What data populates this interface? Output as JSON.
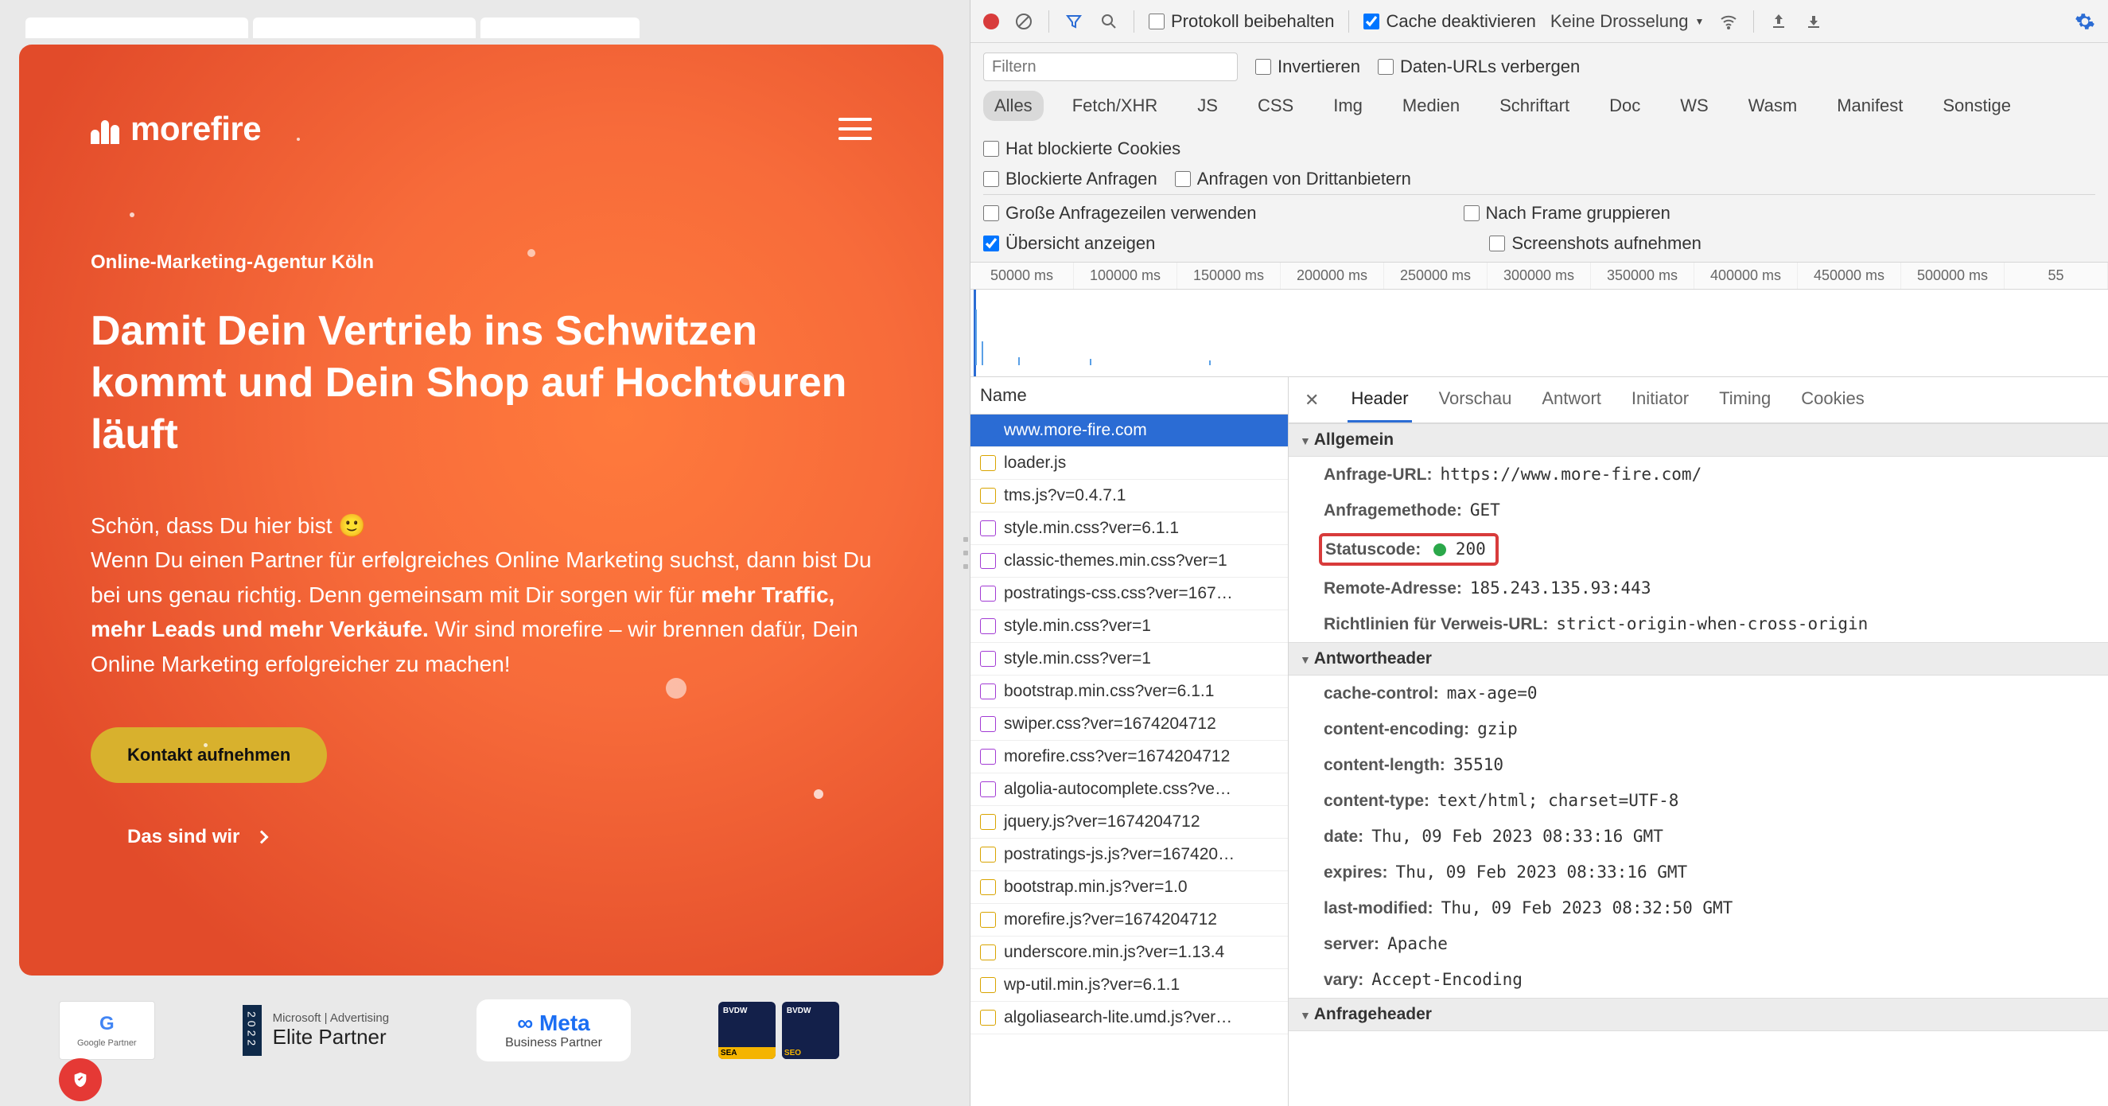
{
  "site": {
    "logo_text": "morefire",
    "eyebrow": "Online-Marketing-Agentur Köln",
    "headline": "Damit Dein Vertrieb ins Schwitzen kommt und Dein Shop auf Hochtouren läuft",
    "intro_l1": "Schön, dass Du hier bist 🙂",
    "intro_l2a": "Wenn Du einen Partner für erfolgreiches Online Marketing suchst, dann bist Du bei uns genau richtig. Denn gemeinsam mit Dir sorgen wir für ",
    "intro_bold": "mehr Traffic, mehr Leads und mehr Verkäufe.",
    "intro_l2b": " Wir sind morefire – wir brennen dafür, Dein Online Marketing erfolgreicher zu machen!",
    "cta_primary": "Kontakt aufnehmen",
    "cta_secondary": "Das sind wir",
    "partners": {
      "google_l1": "G",
      "google_l2": "Google Partner",
      "ms_l1": "Microsoft | Advertising",
      "ms_l2": "Elite Partner",
      "ms_year": "2022",
      "meta_l1": "∞ Meta",
      "meta_l2": "Business Partner",
      "bvdw_l1": "BVDW",
      "bvdw_sea": "SEA",
      "bvdw_seo": "SEO"
    }
  },
  "devtools": {
    "toolbar": {
      "preserve_log": "Protokoll beibehalten",
      "disable_cache": "Cache deaktivieren",
      "throttling": "Keine Drosselung"
    },
    "filter": {
      "placeholder": "Filtern",
      "invert": "Invertieren",
      "hide_data_urls": "Daten-URLs verbergen"
    },
    "types": [
      "Alles",
      "Fetch/XHR",
      "JS",
      "CSS",
      "Img",
      "Medien",
      "Schriftart",
      "Doc",
      "WS",
      "Wasm",
      "Manifest",
      "Sonstige"
    ],
    "blocked_cookies": "Hat blockierte Cookies",
    "blocked_requests": "Blockierte Anfragen",
    "third_party": "Anfragen von Drittanbietern",
    "large_rows": "Große Anfragezeilen verwenden",
    "group_by_frame": "Nach Frame gruppieren",
    "show_overview": "Übersicht anzeigen",
    "screenshots": "Screenshots aufnehmen",
    "timeline_ticks": [
      "50000 ms",
      "100000 ms",
      "150000 ms",
      "200000 ms",
      "250000 ms",
      "300000 ms",
      "350000 ms",
      "400000 ms",
      "450000 ms",
      "500000 ms",
      "55"
    ],
    "name_header": "Name",
    "requests": [
      {
        "name": "www.more-fire.com",
        "type": "doc",
        "selected": true
      },
      {
        "name": "loader.js",
        "type": "js"
      },
      {
        "name": "tms.js?v=0.4.7.1",
        "type": "js"
      },
      {
        "name": "style.min.css?ver=6.1.1",
        "type": "css"
      },
      {
        "name": "classic-themes.min.css?ver=1",
        "type": "css"
      },
      {
        "name": "postratings-css.css?ver=167…",
        "type": "css"
      },
      {
        "name": "style.min.css?ver=1",
        "type": "css"
      },
      {
        "name": "style.min.css?ver=1",
        "type": "css"
      },
      {
        "name": "bootstrap.min.css?ver=6.1.1",
        "type": "css"
      },
      {
        "name": "swiper.css?ver=1674204712",
        "type": "css"
      },
      {
        "name": "morefire.css?ver=1674204712",
        "type": "css"
      },
      {
        "name": "algolia-autocomplete.css?ve…",
        "type": "css"
      },
      {
        "name": "jquery.js?ver=1674204712",
        "type": "js"
      },
      {
        "name": "postratings-js.js?ver=167420…",
        "type": "js"
      },
      {
        "name": "bootstrap.min.js?ver=1.0",
        "type": "js"
      },
      {
        "name": "morefire.js?ver=1674204712",
        "type": "js"
      },
      {
        "name": "underscore.min.js?ver=1.13.4",
        "type": "js"
      },
      {
        "name": "wp-util.min.js?ver=6.1.1",
        "type": "js"
      },
      {
        "name": "algoliasearch-lite.umd.js?ver…",
        "type": "js"
      }
    ],
    "detail_tabs": [
      "Header",
      "Vorschau",
      "Antwort",
      "Initiator",
      "Timing",
      "Cookies"
    ],
    "sections": {
      "general": "Allgemein",
      "response_headers": "Antwortheader",
      "request_headers": "Anfrageheader"
    },
    "general": {
      "request_url_k": "Anfrage-URL:",
      "request_url_v": "https://www.more-fire.com/",
      "request_method_k": "Anfragemethode:",
      "request_method_v": "GET",
      "status_k": "Statuscode:",
      "status_v": "200",
      "remote_k": "Remote-Adresse:",
      "remote_v": "185.243.135.93:443",
      "referrer_k": "Richtlinien für Verweis-URL:",
      "referrer_v": "strict-origin-when-cross-origin"
    },
    "response_headers": [
      {
        "k": "cache-control:",
        "v": "max-age=0"
      },
      {
        "k": "content-encoding:",
        "v": "gzip"
      },
      {
        "k": "content-length:",
        "v": "35510"
      },
      {
        "k": "content-type:",
        "v": "text/html; charset=UTF-8"
      },
      {
        "k": "date:",
        "v": "Thu, 09 Feb 2023 08:33:16 GMT"
      },
      {
        "k": "expires:",
        "v": "Thu, 09 Feb 2023 08:33:16 GMT"
      },
      {
        "k": "last-modified:",
        "v": "Thu, 09 Feb 2023 08:32:50 GMT"
      },
      {
        "k": "server:",
        "v": "Apache"
      },
      {
        "k": "vary:",
        "v": "Accept-Encoding"
      }
    ]
  }
}
